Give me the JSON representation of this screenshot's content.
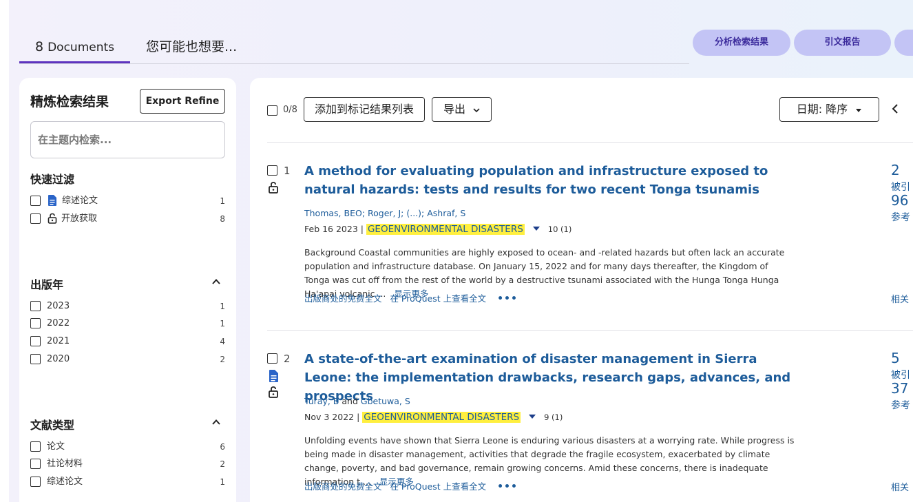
{
  "tabs": {
    "docs_count": "8",
    "docs_label": "Documents",
    "more_label": "您可能也想要..."
  },
  "actions": {
    "analyze": "分析检索结果",
    "citation_report": "引文报告"
  },
  "refine": {
    "title": "精炼检索结果",
    "export_label": "Export Refine",
    "search_placeholder": "在主题内检索...",
    "quick_filters": {
      "heading": "快速过滤",
      "items": [
        {
          "label": "综述论文",
          "count": "1",
          "icon": "document-icon"
        },
        {
          "label": "开放获取",
          "count": "8",
          "icon": "open-lock-icon"
        }
      ]
    },
    "pub_year": {
      "heading": "出版年",
      "items": [
        {
          "label": "2023",
          "count": "1"
        },
        {
          "label": "2022",
          "count": "1"
        },
        {
          "label": "2021",
          "count": "4"
        },
        {
          "label": "2020",
          "count": "2"
        }
      ]
    },
    "doc_type": {
      "heading": "文献类型",
      "items": [
        {
          "label": "论文",
          "count": "6"
        },
        {
          "label": "社论材料",
          "count": "2"
        },
        {
          "label": "综述论文",
          "count": "1"
        }
      ]
    }
  },
  "toolbar": {
    "selected": "0/8",
    "add_to_marked": "添加到标记结果列表",
    "export": "导出",
    "sort": "日期: 降序"
  },
  "records": [
    {
      "num": "1",
      "title": "A method for evaluating population and infrastructure exposed to natural hazards: tests and results for two recent Tonga tsunamis",
      "authors": "Thomas, BEO; Roger, J; (...); Ashraf, S",
      "date": "Feb 16 2023 |",
      "journal": "GEOENVIRONMENTAL DISASTERS",
      "volume": "10 (1)",
      "abstract": "Background Coastal communities are highly exposed to ocean- and -related hazards but often lack an accurate population and infrastructure database. On January 15, 2022 and for many days thereafter, the Kingdom of Tonga was cut off from the rest of the world by a destructive tsunami associated with the Hunga Tonga Hunga Ha'apai volcanic ...",
      "show_more": "显示更多",
      "link_free": "出版商处的免费全文",
      "link_proquest": "在 ProQuest 上查看全文",
      "more_dots": "•••",
      "cited_count": "2",
      "cited_label": "被引",
      "ref_count": "96",
      "ref_label": "参考",
      "related_label": "相关"
    },
    {
      "num": "2",
      "title": "A state-of-the-art examination of disaster management in Sierra Leone: the implementation drawbacks, research gaps, advances, and prospects",
      "author1": "Turay, B",
      "author_and": "and",
      "author2": "Gbetuwa, S",
      "date": "Nov 3 2022 |",
      "journal": "GEOENVIRONMENTAL DISASTERS",
      "volume": "9 (1)",
      "abstract": "Unfolding events have shown that Sierra Leone is enduring various disasters at a worrying rate. While progress is being made in disaster management, activities that degrade the fragile ecosystem, exacerbated by climate change, poverty, and bad governance, remain growing concerns. Amid these concerns, there is inadequate information t ...",
      "show_more": "显示更多",
      "link_free": "出版商处的免费全文",
      "link_proquest": "在 ProQuest 上查看全文",
      "more_dots": "•••",
      "cited_count": "5",
      "cited_label": "被引",
      "ref_count": "37",
      "ref_label": "参考",
      "related_label": "相关"
    }
  ]
}
